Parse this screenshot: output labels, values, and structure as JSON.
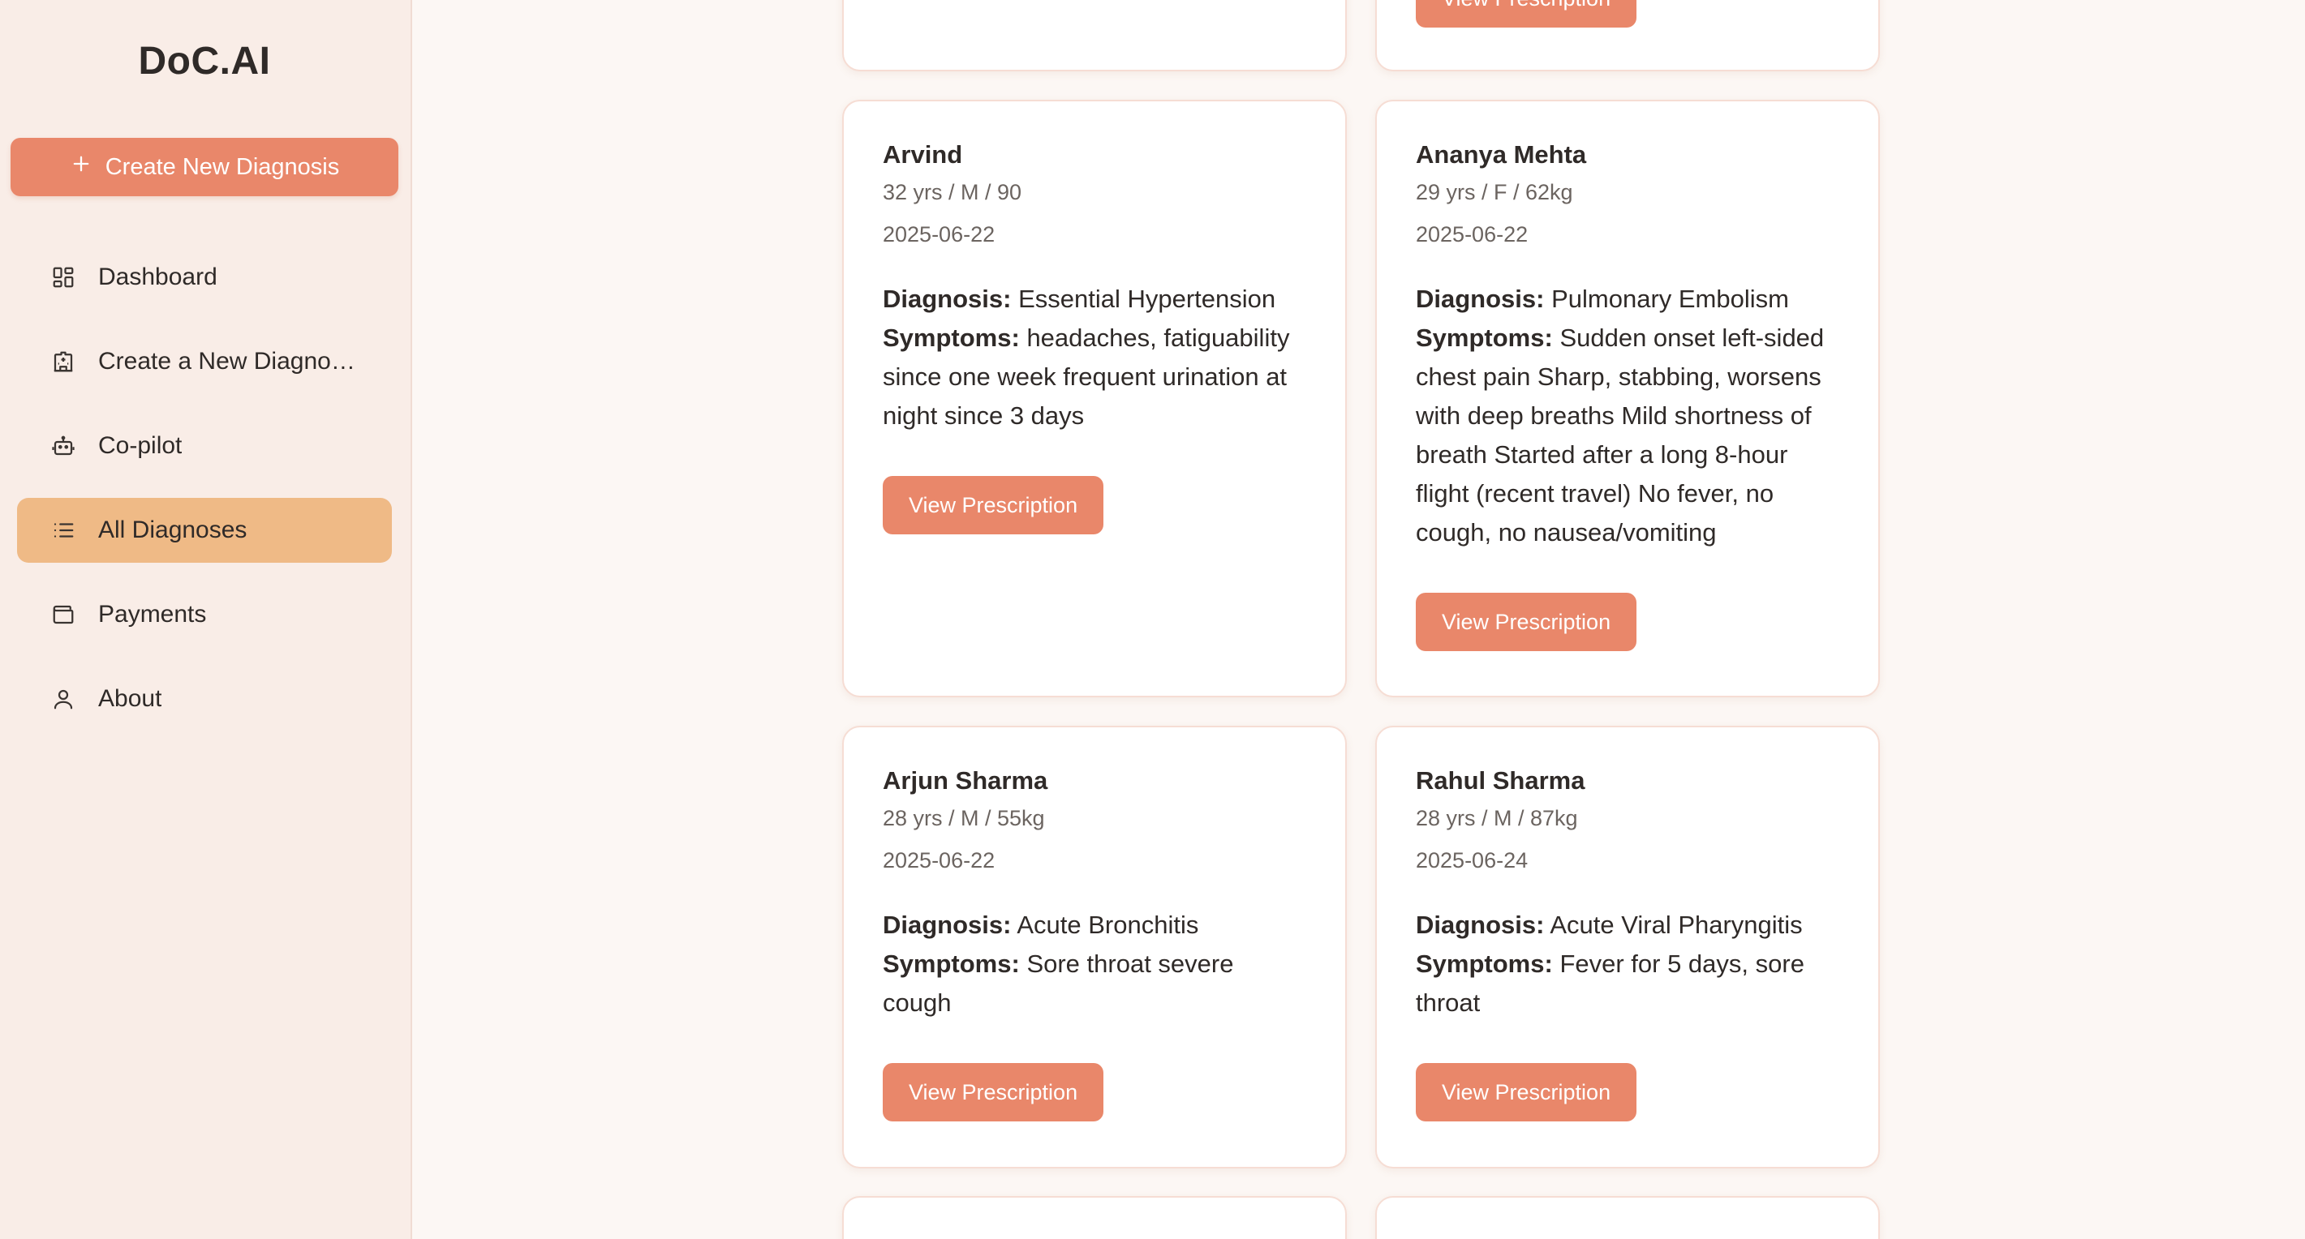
{
  "brand": "DoC.AI",
  "sidebar": {
    "create_button": "Create New Diagnosis",
    "items": [
      {
        "label": "Dashboard",
        "icon": "dashboard-icon"
      },
      {
        "label": "Create a New Diagno…",
        "icon": "hospital-icon"
      },
      {
        "label": "Co-pilot",
        "icon": "robot-icon"
      },
      {
        "label": "All Diagnoses",
        "icon": "list-icon",
        "active": true
      },
      {
        "label": "Payments",
        "icon": "wallet-icon"
      },
      {
        "label": "About",
        "icon": "user-icon"
      }
    ]
  },
  "labels": {
    "diagnosis": "Diagnosis:",
    "symptoms": "Symptoms:",
    "view_prescription": "View Prescription"
  },
  "cards": [
    {
      "name": "Arvind",
      "meta": "32 yrs / M / 90",
      "date": "2025-06-22",
      "diagnosis": "Essential Hypertension",
      "symptoms": "headaches, fatiguability since one week frequent urination at night since 3 days"
    },
    {
      "name": "Ananya Mehta",
      "meta": "29 yrs / F / 62kg",
      "date": "2025-06-22",
      "diagnosis": "Pulmonary Embolism",
      "symptoms": "Sudden onset left-sided chest pain Sharp, stabbing, worsens with deep breaths Mild shortness of breath Started after a long 8-hour flight (recent travel) No fever, no cough, no nausea/vomiting"
    },
    {
      "name": "Arjun Sharma",
      "meta": "28 yrs / M / 55kg",
      "date": "2025-06-22",
      "diagnosis": "Acute Bronchitis",
      "symptoms": "Sore throat severe cough"
    },
    {
      "name": "Rahul Sharma",
      "meta": "28 yrs / M / 87kg",
      "date": "2025-06-24",
      "diagnosis": "Acute Viral Pharyngitis",
      "symptoms": "Fever for 5 days, sore throat"
    }
  ],
  "colors": {
    "accent": "#e9876a",
    "active_nav": "#efba86",
    "sidebar_bg": "#f9ede7",
    "page_bg": "#fcf7f4"
  }
}
